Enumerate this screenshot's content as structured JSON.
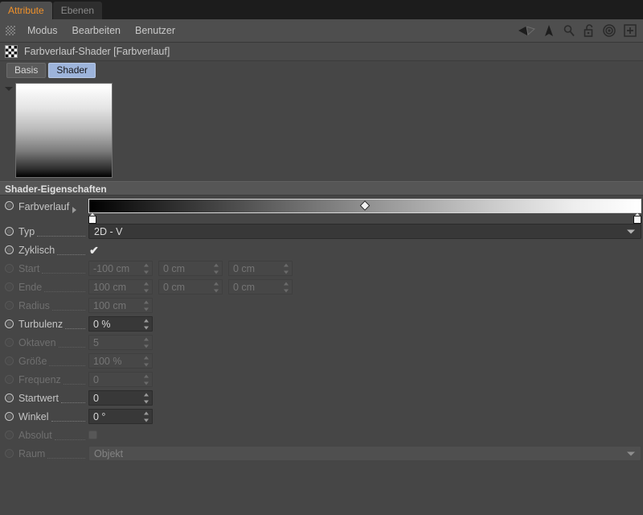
{
  "window": {
    "tabs": [
      {
        "label": "Attribute",
        "active": true
      },
      {
        "label": "Ebenen",
        "active": false
      }
    ],
    "menu": [
      "Modus",
      "Bearbeiten",
      "Benutzer"
    ],
    "menu_icons": [
      "play-back-icon",
      "cursor-arrow-icon",
      "search-icon",
      "unlock-icon",
      "target-icon",
      "plus-box-icon"
    ],
    "title": "Farbverlauf-Shader [Farbverlauf]",
    "title_icon": "checkerboard-icon",
    "subtabs": [
      {
        "label": "Basis",
        "active": false
      },
      {
        "label": "Shader",
        "active": true
      }
    ]
  },
  "preview": {
    "gradient_from": "#ffffff",
    "gradient_to": "#000000"
  },
  "section": {
    "header": "Shader-Eigenschaften"
  },
  "properties": {
    "gradient": {
      "label": "Farbverlauf",
      "animatable": true,
      "enabled": true,
      "bar_from": "#000000",
      "bar_to": "#ffffff",
      "midpoint_pos": "50%",
      "knob_left_pos": "0%",
      "knob_right_pos": "100%"
    },
    "typ": {
      "label": "Typ",
      "value": "2D - V",
      "animatable": true,
      "enabled": true
    },
    "zyklisch": {
      "label": "Zyklisch",
      "checked": true,
      "check_glyph": "✔",
      "animatable": true,
      "enabled": true
    },
    "start": {
      "label": "Start",
      "values": [
        "-100 cm",
        "0 cm",
        "0 cm"
      ],
      "animatable": false,
      "enabled": false
    },
    "ende": {
      "label": "Ende",
      "values": [
        "100 cm",
        "0 cm",
        "0 cm"
      ],
      "animatable": false,
      "enabled": false
    },
    "radius": {
      "label": "Radius",
      "values": [
        "100 cm"
      ],
      "animatable": false,
      "enabled": false
    },
    "turbulenz": {
      "label": "Turbulenz",
      "values": [
        "0 %"
      ],
      "animatable": true,
      "enabled": true
    },
    "oktaven": {
      "label": "Oktaven",
      "values": [
        "5"
      ],
      "animatable": false,
      "enabled": false
    },
    "groesse": {
      "label": "Größe",
      "values": [
        "100 %"
      ],
      "animatable": false,
      "enabled": false
    },
    "frequenz": {
      "label": "Frequenz",
      "values": [
        "0"
      ],
      "animatable": false,
      "enabled": false
    },
    "startwert": {
      "label": "Startwert",
      "values": [
        "0"
      ],
      "animatable": true,
      "enabled": true
    },
    "winkel": {
      "label": "Winkel",
      "values": [
        "0 °"
      ],
      "animatable": true,
      "enabled": true
    },
    "absolut": {
      "label": "Absolut",
      "checked": false,
      "animatable": false,
      "enabled": false
    },
    "raum": {
      "label": "Raum",
      "value": "Objekt",
      "animatable": false,
      "enabled": false
    }
  },
  "colors": {
    "background": "#464646",
    "tabstrip": "#1c1c1c",
    "accent": "#f0912a",
    "active_subtab": "#9db4db",
    "section_header": "#565656"
  }
}
